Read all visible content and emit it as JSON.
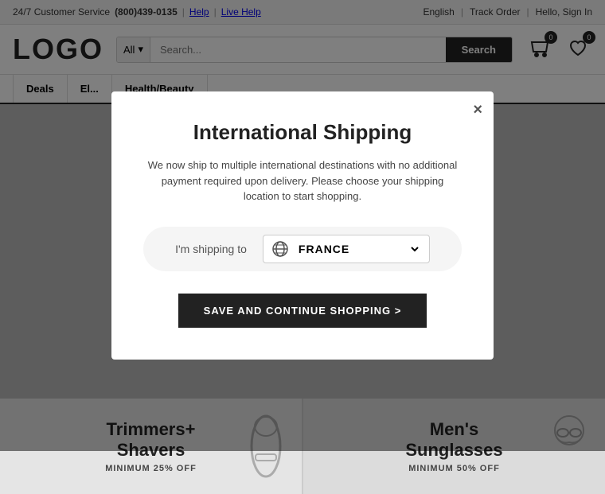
{
  "topbar": {
    "customer_service": "24/7 Customer Service",
    "phone": "(800)439-0135",
    "help": "Help",
    "live_help": "Live Help",
    "language": "English",
    "track_order": "Track Order",
    "hello_sign_in": "Hello, Sign In"
  },
  "header": {
    "logo": "LOGO",
    "search_placeholder": "Search...",
    "search_category": "All",
    "search_button": "Search",
    "cart_count": "0",
    "wishlist_count": "0"
  },
  "nav": {
    "items": [
      {
        "label": "Deals"
      },
      {
        "label": "El..."
      },
      {
        "label": "Health/Beauty"
      }
    ]
  },
  "modal": {
    "title": "International Shipping",
    "description": "We now ship to multiple international destinations with no additional payment required upon delivery. Please choose your shipping location to start shopping.",
    "shipping_label": "I'm shipping to",
    "country": "FRANCE",
    "close_label": "×",
    "continue_button": "SAVE AND CONTINUE SHOPPING >"
  },
  "promo": {
    "left_title": "Trimmers+\nShavers",
    "left_subtitle": "MINIMUM 25% OFF",
    "right_title": "Men's\nSunglasses",
    "right_subtitle": "Minimum 50% off"
  }
}
